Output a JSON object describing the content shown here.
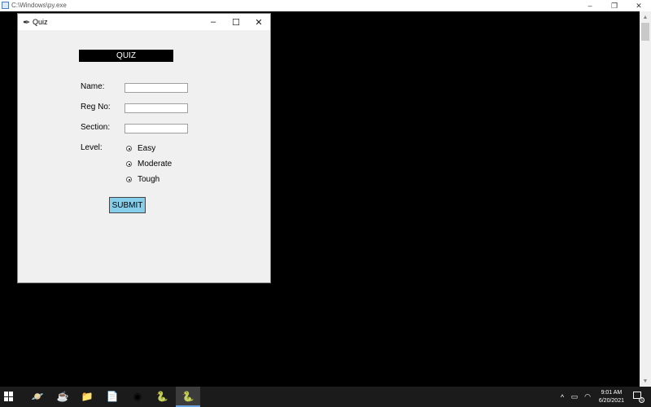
{
  "console": {
    "title": "C:\\Windows\\py.exe",
    "controls": {
      "minimize": "–",
      "restore": "❐",
      "close": "✕"
    }
  },
  "quiz_window": {
    "title": "Quiz",
    "controls": {
      "minimize": "–",
      "maximize": "☐",
      "close": "✕"
    },
    "heading": "QUIZ",
    "fields": [
      {
        "label": "Name:",
        "value": ""
      },
      {
        "label": "Reg No:",
        "value": ""
      },
      {
        "label": "Section:",
        "value": ""
      }
    ],
    "level_label": "Level:",
    "levels": [
      "Easy",
      "Moderate",
      "Tough"
    ],
    "submit_label": "SUBMIT"
  },
  "taskbar": {
    "clock_time": "9:01 AM",
    "clock_date": "6/20/2021",
    "notification_count": "5",
    "colors": {
      "active_underline": "#6aa0e0",
      "background": "#1b1b1b"
    }
  }
}
